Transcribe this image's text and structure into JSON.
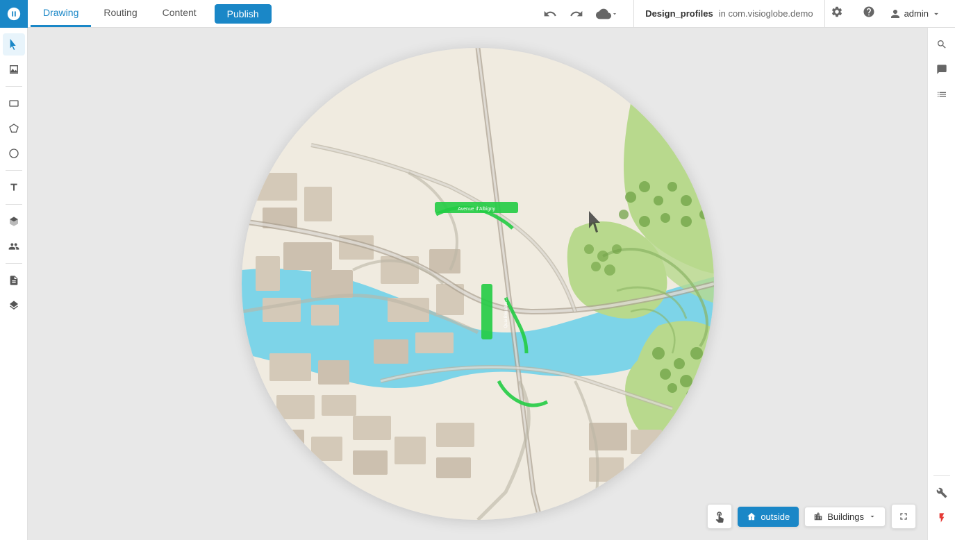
{
  "app": {
    "logo_title": "Visioglobe",
    "tabs": [
      {
        "id": "drawing",
        "label": "Drawing",
        "active": true
      },
      {
        "id": "routing",
        "label": "Routing",
        "active": false
      },
      {
        "id": "content",
        "label": "Content",
        "active": false
      }
    ],
    "publish_label": "Publish"
  },
  "project": {
    "name": "Design_profiles",
    "context": "in com.visioglobe.demo"
  },
  "toolbar": {
    "undo_label": "Undo",
    "redo_label": "Redo",
    "cloud_label": "Cloud"
  },
  "left_tools": [
    {
      "id": "select",
      "icon": "▲",
      "label": "Select tool",
      "active": true
    },
    {
      "id": "analytics",
      "icon": "📈",
      "label": "Analytics tool",
      "active": false
    },
    {
      "id": "rectangle",
      "icon": "▭",
      "label": "Rectangle tool",
      "active": false
    },
    {
      "id": "polygon",
      "icon": "⬠",
      "label": "Polygon tool",
      "active": false
    },
    {
      "id": "circle",
      "icon": "○",
      "label": "Circle tool",
      "active": false
    },
    {
      "id": "text",
      "icon": "T",
      "label": "Text tool",
      "active": false
    },
    {
      "id": "3d",
      "icon": "⬡",
      "label": "3D tool",
      "active": false
    },
    {
      "id": "people",
      "icon": "👤",
      "label": "People tool",
      "active": false
    },
    {
      "id": "layers2",
      "icon": "📄",
      "label": "Layers bottom",
      "active": false
    },
    {
      "id": "layers",
      "icon": "⬡",
      "label": "Layers tool",
      "active": false
    }
  ],
  "right_panel": {
    "search_label": "Search",
    "comments_label": "Comments",
    "checklist_label": "Checklist",
    "wrench_label": "Wrench",
    "lightning_label": "Lightning"
  },
  "bottom_bar": {
    "hand_label": "Pan tool",
    "outside_label": "outside",
    "buildings_label": "Buildings",
    "fullscreen_label": "Fullscreen"
  },
  "map": {
    "background_color": "#e8e8e8",
    "water_color": "#7dd4e8",
    "green_color": "#b8d98d",
    "dark_green_color": "#8ab464",
    "road_color": "#c8c0b0",
    "building_color": "#d4c9b8",
    "path_color": "#aaa090",
    "highlight_blue": "#4a90d9"
  }
}
